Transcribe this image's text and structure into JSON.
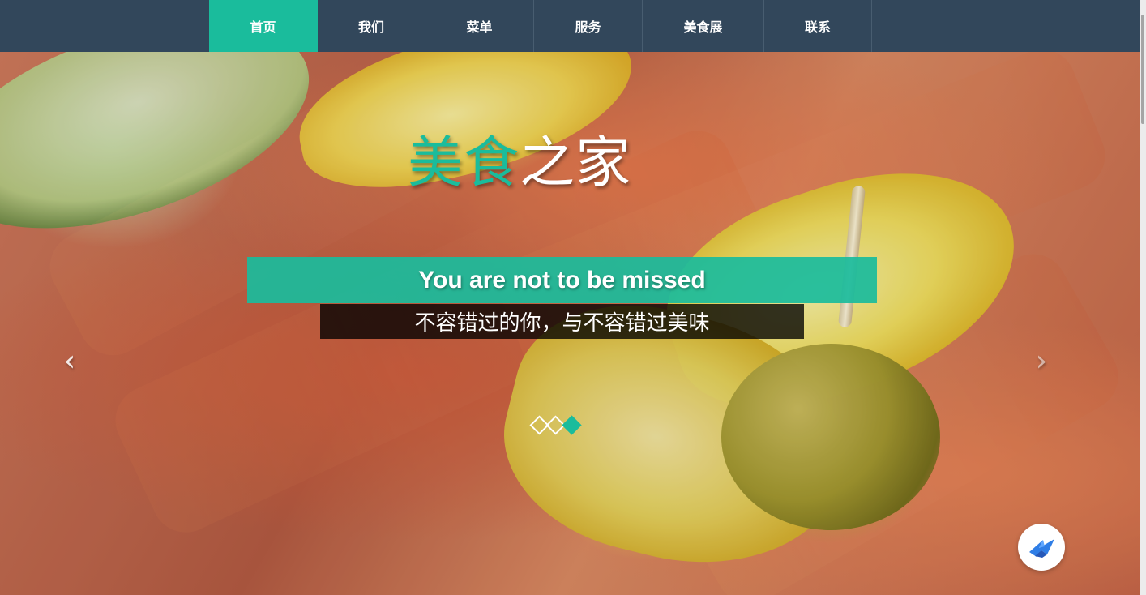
{
  "nav": {
    "items": [
      {
        "label": "首页",
        "active": true
      },
      {
        "label": "我们",
        "active": false
      },
      {
        "label": "菜单",
        "active": false
      },
      {
        "label": "服务",
        "active": false
      },
      {
        "label": "美食展",
        "active": false
      },
      {
        "label": "联系",
        "active": false
      }
    ]
  },
  "hero": {
    "title_green": "美食",
    "title_white": "之家",
    "tagline": "You are not to be missed",
    "subtitle": "不容错过的你，与不容错过美味"
  },
  "carousel": {
    "left_arrow_icon": "chevron-left-icon",
    "right_arrow_icon": "chevron-right-icon",
    "indicators": [
      {
        "active": false
      },
      {
        "active": false
      },
      {
        "active": true
      }
    ]
  },
  "floating_button": {
    "icon": "bird-icon"
  },
  "colors": {
    "nav_bg": "#32475b",
    "accent": "#1abc9c",
    "dark_overlay": "#000000",
    "text_light": "#ffffff"
  }
}
